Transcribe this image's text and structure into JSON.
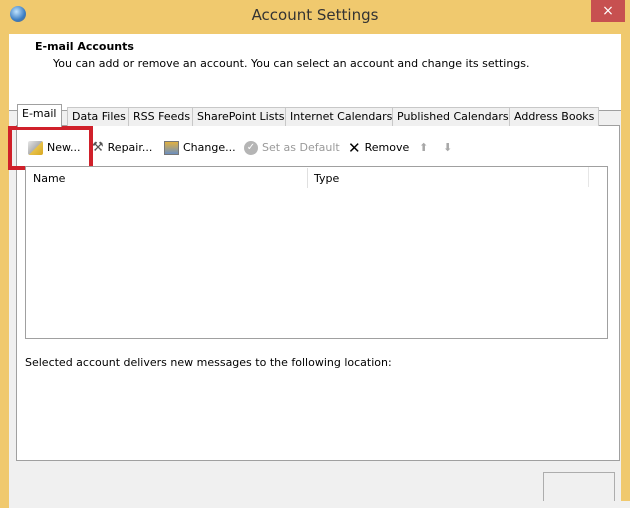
{
  "window": {
    "title": "Account Settings",
    "close_label": "×"
  },
  "header": {
    "title": "E-mail Accounts",
    "subtitle": "You can add or remove an account. You can select an account and change its settings."
  },
  "tabs": [
    {
      "label": "E-mail",
      "active": true
    },
    {
      "label": "Data Files"
    },
    {
      "label": "RSS Feeds"
    },
    {
      "label": "SharePoint Lists"
    },
    {
      "label": "Internet Calendars"
    },
    {
      "label": "Published Calendars"
    },
    {
      "label": "Address Books"
    }
  ],
  "toolbar": {
    "new": "New...",
    "repair": "Repair...",
    "change": "Change...",
    "set_default": "Set as Default",
    "remove": "Remove",
    "move_up_icon": "arrow-up-icon",
    "move_down_icon": "arrow-down-icon"
  },
  "list": {
    "columns": [
      "Name",
      "Type"
    ],
    "rows": []
  },
  "location_text": "Selected account delivers new messages to the following location:",
  "colors": {
    "frame": "#f0c96e",
    "close": "#c75050",
    "highlight": "#d0202a"
  }
}
